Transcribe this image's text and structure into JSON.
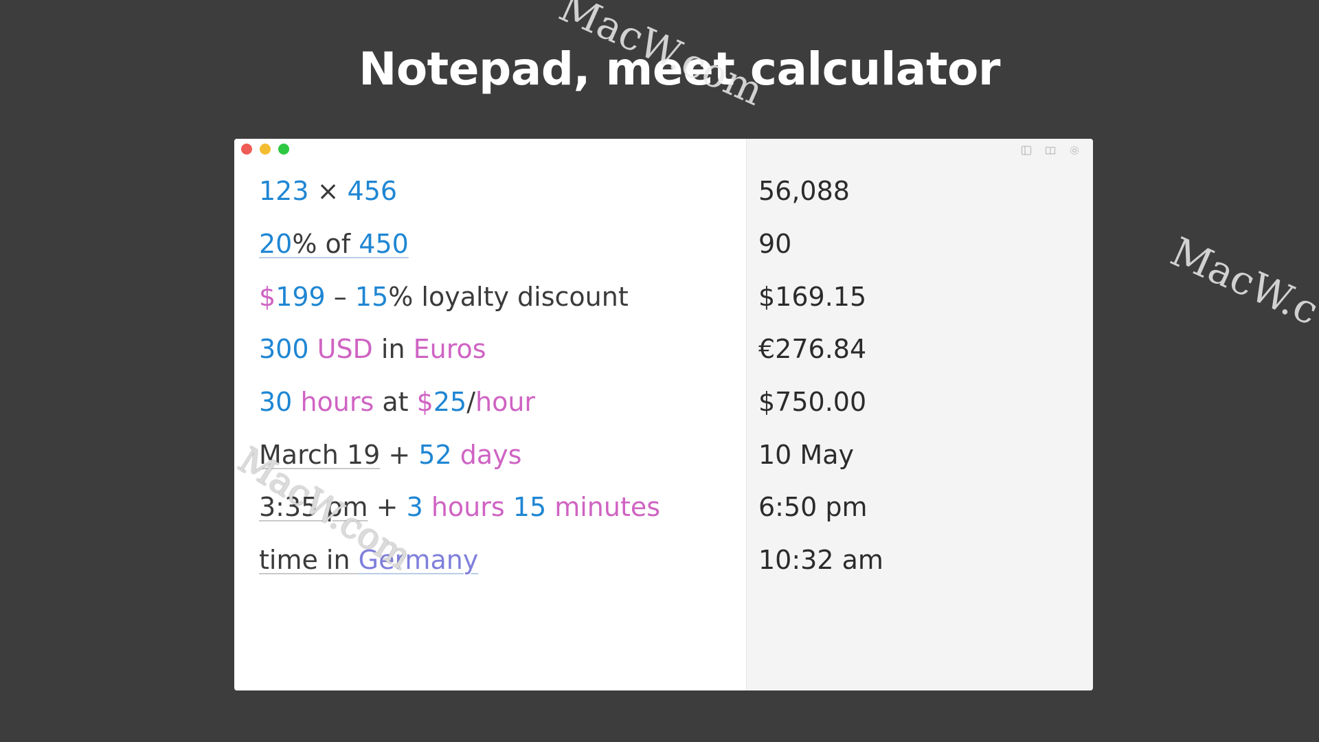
{
  "headline": "Notepad, meet calculator",
  "watermarks": {
    "top": "MacW.com",
    "right": "MacW.c",
    "middle": "MacW.com"
  },
  "window": {
    "controls": [
      "close",
      "minimize",
      "maximize"
    ],
    "toolbar_icons": [
      "sidebar-icon",
      "book-icon",
      "gear-icon"
    ]
  },
  "colors": {
    "number": "#1f86d3",
    "unit": "#cf63c3",
    "place": "#7e7fdb",
    "text": "#3a3a3a",
    "result_pane": "#f4f4f4"
  },
  "lines": [
    {
      "tokens": [
        {
          "t": "123",
          "c": "n"
        },
        {
          "t": " × ",
          "c": ""
        },
        {
          "t": "456",
          "c": "n"
        }
      ]
    },
    {
      "tokens": [
        {
          "t": "20",
          "c": "n ul"
        },
        {
          "t": "% of ",
          "c": "ul"
        },
        {
          "t": "450",
          "c": "n ul"
        }
      ]
    },
    {
      "tokens": [
        {
          "t": "$",
          "c": "u"
        },
        {
          "t": "199",
          "c": "n"
        },
        {
          "t": " – ",
          "c": ""
        },
        {
          "t": "15",
          "c": "n"
        },
        {
          "t": "% loyalty discount",
          "c": ""
        }
      ]
    },
    {
      "tokens": [
        {
          "t": "300",
          "c": "n"
        },
        {
          "t": " ",
          "c": ""
        },
        {
          "t": "USD",
          "c": "u"
        },
        {
          "t": " in ",
          "c": ""
        },
        {
          "t": "Euros",
          "c": "u"
        }
      ]
    },
    {
      "tokens": [
        {
          "t": "30",
          "c": "n"
        },
        {
          "t": " ",
          "c": ""
        },
        {
          "t": "hours",
          "c": "u"
        },
        {
          "t": " at ",
          "c": ""
        },
        {
          "t": "$",
          "c": "u"
        },
        {
          "t": "25",
          "c": "n"
        },
        {
          "t": "/",
          "c": ""
        },
        {
          "t": "hour",
          "c": "u"
        }
      ]
    },
    {
      "tokens": [
        {
          "t": "March 19",
          "c": "ul-gray"
        },
        {
          "t": " + ",
          "c": ""
        },
        {
          "t": "52",
          "c": "n"
        },
        {
          "t": " ",
          "c": ""
        },
        {
          "t": "days",
          "c": "u"
        }
      ]
    },
    {
      "tokens": [
        {
          "t": "3:35 pm",
          "c": "ul-gray"
        },
        {
          "t": " + ",
          "c": ""
        },
        {
          "t": "3",
          "c": "n"
        },
        {
          "t": " ",
          "c": ""
        },
        {
          "t": "hours",
          "c": "u"
        },
        {
          "t": " ",
          "c": ""
        },
        {
          "t": "15",
          "c": "n"
        },
        {
          "t": " ",
          "c": ""
        },
        {
          "t": "minutes",
          "c": "u"
        }
      ]
    },
    {
      "tokens": [
        {
          "t": "time in ",
          "c": "ul-gray"
        },
        {
          "t": "Germany",
          "c": "p ul"
        }
      ]
    }
  ],
  "results": [
    "56,088",
    "90",
    "$169.15",
    "€276.84",
    "$750.00",
    "10 May",
    "6:50 pm",
    "10:32 am"
  ]
}
